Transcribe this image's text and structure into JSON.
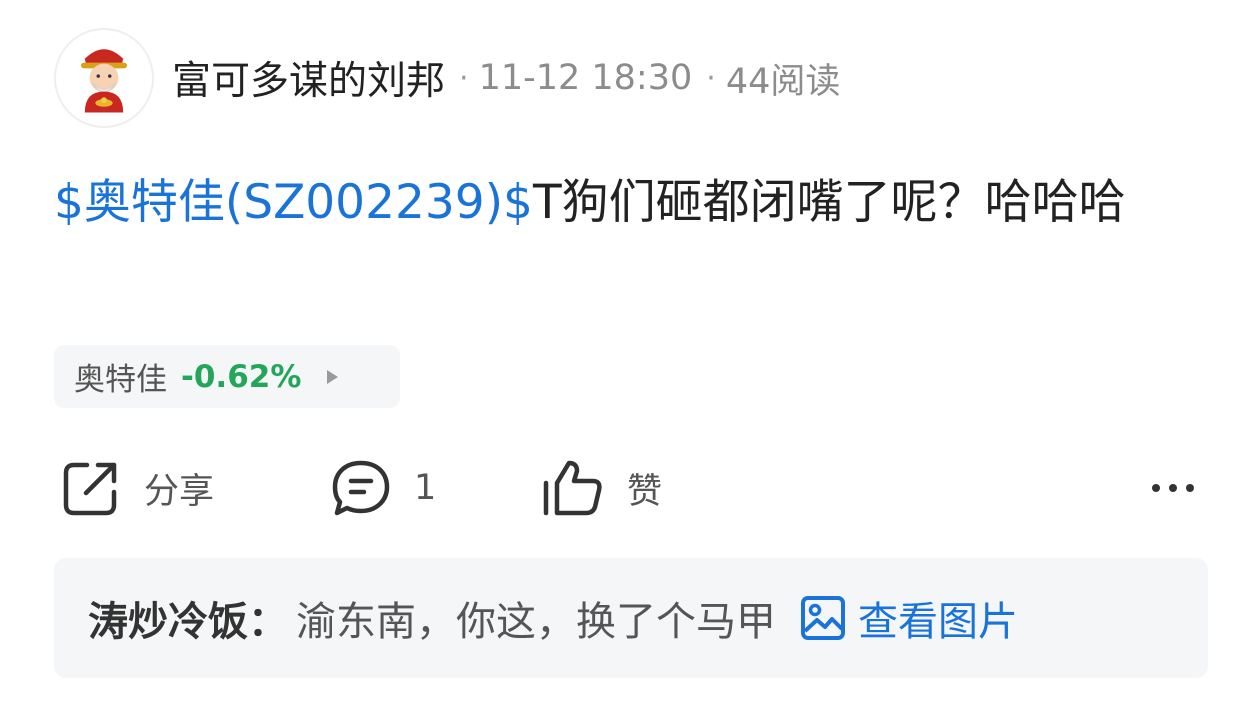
{
  "post": {
    "author": "富可多谋的刘邦",
    "separator": "·",
    "timestamp": "11-12 18:30",
    "reads": "44阅读",
    "stock_tag": "$奥特佳(SZ002239)$",
    "body": "T狗们砸都闭嘴了呢？哈哈哈"
  },
  "stock_chip": {
    "name": "奥特佳",
    "change": "-0.62%",
    "change_color": "#24a65a"
  },
  "actions": {
    "share_label": "分享",
    "comment_count": "1",
    "like_label": "赞",
    "share_icon": "share-icon",
    "comment_icon": "comment-icon",
    "like_icon": "thumbs-up-icon",
    "more_icon": "more-icon"
  },
  "comment_preview": {
    "user": "涛炒冷饭",
    "colon": "：",
    "text": "渝东南，你这，换了个马甲",
    "view_image_label": "查看图片",
    "image_icon": "image-icon"
  },
  "colors": {
    "link_blue": "#1a73d9",
    "down_green": "#24a65a",
    "card_bg": "#f5f6f8"
  }
}
